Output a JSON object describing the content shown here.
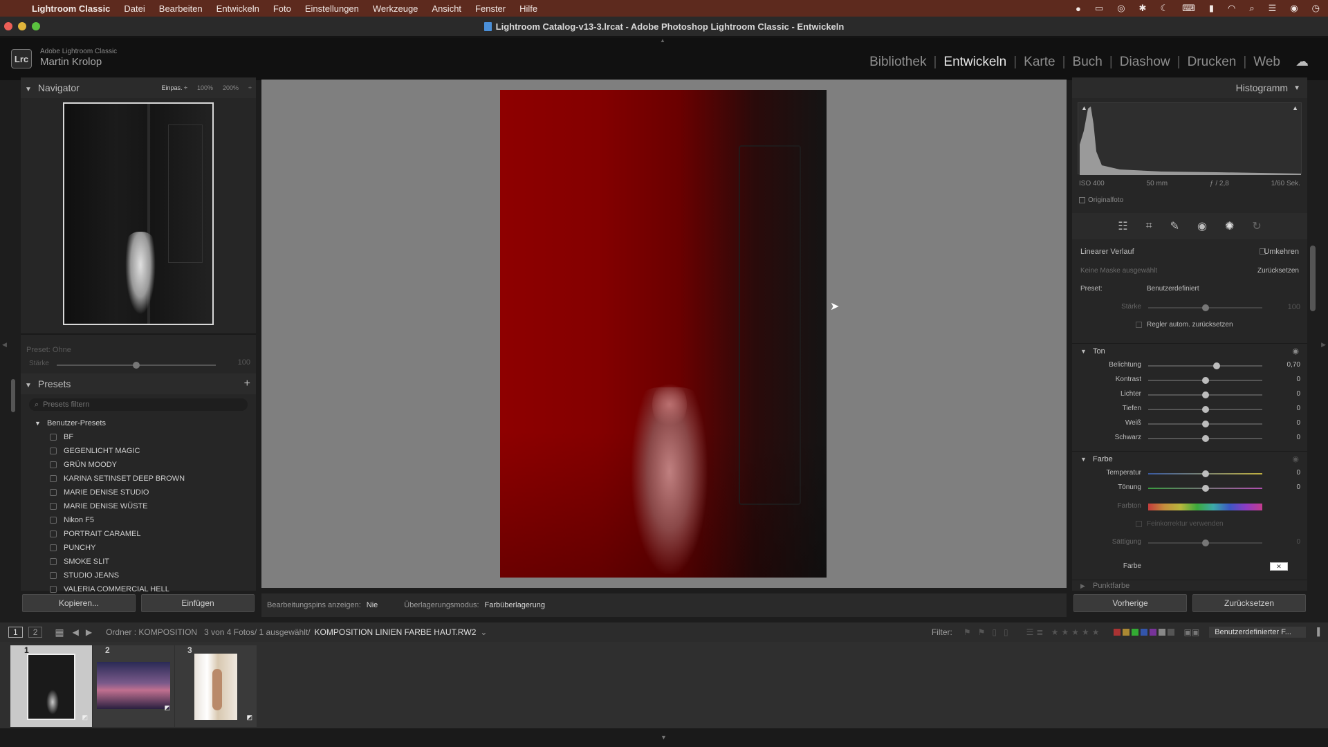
{
  "menubar": {
    "items": [
      "Lightroom Classic",
      "Datei",
      "Bearbeiten",
      "Entwickeln",
      "Foto",
      "Einstellungen",
      "Werkzeuge",
      "Ansicht",
      "Fenster",
      "Hilfe"
    ]
  },
  "window": {
    "title": "Lightroom Catalog-v13-3.lrcat - Adobe Photoshop Lightroom Classic - Entwickeln"
  },
  "identity": {
    "badge": "Lrc",
    "product": "Adobe Lightroom Classic",
    "user": "Martin Krolop"
  },
  "modules": [
    "Bibliothek",
    "Entwickeln",
    "Karte",
    "Buch",
    "Diashow",
    "Drucken",
    "Web"
  ],
  "navigator": {
    "title": "Navigator",
    "zoom": [
      "Einpas. ÷",
      "100%",
      "200%",
      "÷"
    ]
  },
  "preset_amount": {
    "label_preset": "Preset: Ohne",
    "label_amount": "Stärke",
    "value": "100"
  },
  "presets": {
    "title": "Presets",
    "add": "+",
    "search_placeholder": "Presets filtern",
    "group": "Benutzer-Presets",
    "items": [
      "BF",
      "GEGENLICHT MAGIC",
      "GRÜN MOODY",
      "KARINA SETINSET DEEP BROWN",
      "MARIE DENISE STUDIO",
      "MARIE DENISE WÜSTE",
      "Nikon F5",
      "PORTRAIT CARAMEL",
      "PUNCHY",
      "SMOKE SLIT",
      "STUDIO JEANS",
      "VALERIA COMMERCIAL HELL"
    ]
  },
  "left_buttons": {
    "copy": "Kopieren...",
    "paste": "Einfügen"
  },
  "toolbar": {
    "pins_label": "Bearbeitungspins anzeigen:",
    "pins_value": "Nie",
    "overlay_label": "Überlagerungsmodus:",
    "overlay_value": "Farbüberlagerung"
  },
  "histogram": {
    "title": "Histogramm",
    "iso": "ISO 400",
    "focal": "50 mm",
    "aperture": "ƒ / 2,8",
    "shutter": "1/60 Sek.",
    "original": "Originalfoto"
  },
  "mask": {
    "type": "Linearer Verlauf",
    "invert": "Umkehren",
    "no_mask": "Keine Maske ausgewählt",
    "reset": "Zurücksetzen",
    "preset_label": "Preset:",
    "preset_value": "Benutzerdefiniert",
    "amount_label": "Stärke",
    "amount_value": "100",
    "auto_reset": "Regler autom. zurücksetzen"
  },
  "tone": {
    "title": "Ton",
    "rows": [
      {
        "label": "Belichtung",
        "value": "0,70"
      },
      {
        "label": "Kontrast",
        "value": "0"
      },
      {
        "label": "Lichter",
        "value": "0"
      },
      {
        "label": "Tiefen",
        "value": "0"
      },
      {
        "label": "Weiß",
        "value": "0"
      },
      {
        "label": "Schwarz",
        "value": "0"
      }
    ]
  },
  "color": {
    "title": "Farbe",
    "temp_label": "Temperatur",
    "temp_value": "0",
    "tint_label": "Tönung",
    "tint_value": "0",
    "hue_label": "Farbton",
    "fine_label": "Feinkorrektur verwenden",
    "sat_label": "Sättigung",
    "sat_value": "0",
    "swatch_label": "Farbe",
    "next_section": "Punktfarbe"
  },
  "right_buttons": {
    "previous": "Vorherige",
    "reset": "Zurücksetzen"
  },
  "filmstrip": {
    "screen1": "1",
    "screen2": "2",
    "path_label": "Ordner : KOMPOSITION",
    "count": "3 von 4 Fotos/ 1 ausgewählt/",
    "filename": "KOMPOSITION LINIEN FARBE HAUT.RW2",
    "filter_label": "Filter:",
    "filter_preset": "Benutzerdefinierter F...",
    "thumbs": [
      {
        "num": "1"
      },
      {
        "num": "2"
      },
      {
        "num": "3"
      }
    ]
  },
  "colors": {
    "accent": "#5d2a1e",
    "photo_red": "#8e0000",
    "panel": "#262626"
  }
}
